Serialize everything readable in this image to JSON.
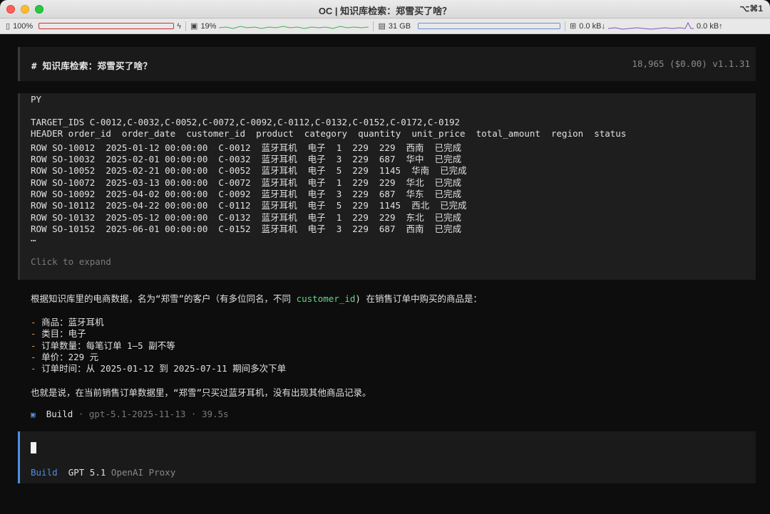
{
  "window": {
    "title": "OC | 知识库检索：郑雪买了啥？",
    "shortcut": "⌥⌘1"
  },
  "statusbar": {
    "battery": "100%",
    "cpu": "19%",
    "memory": "31 GB",
    "net_down": "0.0 kB↓",
    "net_up": "0.0 kB↑",
    "icons": [
      "battery-icon",
      "bolt-icon",
      "cpu-icon",
      "memory-icon",
      "network-icon"
    ]
  },
  "session": {
    "title": "# 知识库检索：郑雪买了啥？",
    "meta": "18,965 ($0.00) v1.1.31"
  },
  "tool_output": {
    "lang": "PY",
    "target_ids": "TARGET_IDS C-0012,C-0032,C-0052,C-0072,C-0092,C-0112,C-0132,C-0152,C-0172,C-0192",
    "header": "HEADER order_id  order_date  customer_id  product  category  quantity  unit_price  total_amount  region  status",
    "rows": [
      "ROW SO-10012  2025-01-12 00:00:00  C-0012  蓝牙耳机  电子  1  229  229  西南  已完成",
      "ROW SO-10032  2025-02-01 00:00:00  C-0032  蓝牙耳机  电子  3  229  687  华中  已完成",
      "ROW SO-10052  2025-02-21 00:00:00  C-0052  蓝牙耳机  电子  5  229  1145  华南  已完成",
      "ROW SO-10072  2025-03-13 00:00:00  C-0072  蓝牙耳机  电子  1  229  229  华北  已完成",
      "ROW SO-10092  2025-04-02 00:00:00  C-0092  蓝牙耳机  电子  3  229  687  华东  已完成",
      "ROW SO-10112  2025-04-22 00:00:00  C-0112  蓝牙耳机  电子  5  229  1145  西北  已完成",
      "ROW SO-10132  2025-05-12 00:00:00  C-0132  蓝牙耳机  电子  1  229  229  东北  已完成",
      "ROW SO-10152  2025-06-01 00:00:00  C-0152  蓝牙耳机  电子  3  229  687  西南  已完成"
    ],
    "ellipsis": "…",
    "expand": "Click to expand"
  },
  "answer": {
    "intro_before": "根据知识库里的电商数据，名为“郑雪”的客户（有多位同名，不同 ",
    "intro_code": "customer_id",
    "intro_after": ") 在销售订单中购买的商品是：",
    "bullets": [
      "商品：蓝牙耳机",
      "类目：电子",
      "订单数量：每笔订单 1–5 副不等",
      "单价：229 元",
      "订单时间：从 2025-01-12 到 2025-07-11 期间多次下单"
    ],
    "bullet_marker": "-",
    "conclusion": "也就是说，在当前销售订单数据里，“郑雪”只买过蓝牙耳机，没有出现其他商品记录。"
  },
  "build": {
    "icon": "▣",
    "label": "Build",
    "meta": " · gpt-5.1-2025-11-13 · 39.5s"
  },
  "input": {
    "mode": "Build",
    "model": "GPT 5.1",
    "provider": "OpenAI Proxy"
  }
}
